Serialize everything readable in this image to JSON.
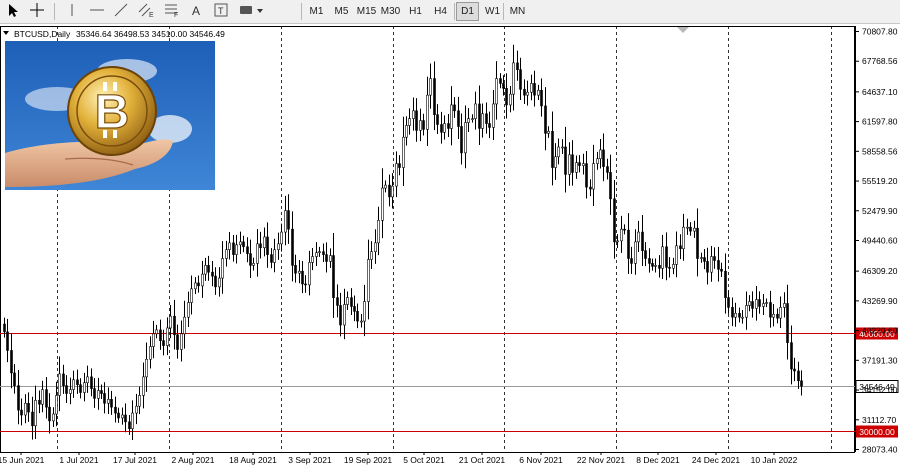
{
  "toolbar": {
    "tools": [
      {
        "icon": "cursor-arrow-icon"
      },
      {
        "icon": "crosshair-icon"
      },
      {
        "icon": "vertical-line-icon"
      },
      {
        "icon": "horizontal-line-icon"
      },
      {
        "icon": "trendline-icon"
      },
      {
        "icon": "channel-icon",
        "label": "E"
      },
      {
        "icon": "fibonacci-icon",
        "label": "F"
      },
      {
        "icon": "text-tool-icon",
        "label": "A"
      },
      {
        "icon": "text-label-icon",
        "label": "T"
      },
      {
        "icon": "shapes-icon"
      }
    ],
    "timeframes": [
      "M1",
      "M5",
      "M15",
      "M30",
      "H1",
      "H4",
      "D1",
      "W1",
      "MN"
    ],
    "active_timeframe": "D1"
  },
  "chart_data": {
    "type": "candlestick",
    "symbol": "BTCUSD,Daily",
    "ohlc_header": "35346.64 36498.53 34510.00 34546.49",
    "y_ticks": [
      "70807.80",
      "67768.56",
      "64637.10",
      "61597.80",
      "58558.56",
      "55519.20",
      "52479.90",
      "49440.60",
      "46309.20",
      "43269.90",
      "40230.60",
      "37191.30",
      "34152.00",
      "31112.70",
      "28073.40"
    ],
    "ylim": [
      28073.4,
      70807.8
    ],
    "x_labels": [
      "15 Jun 2021",
      "1 Jul 2021",
      "17 Jul 2021",
      "2 Aug 2021",
      "18 Aug 2021",
      "3 Sep 2021",
      "19 Sep 2021",
      "5 Oct 2021",
      "21 Oct 2021",
      "6 Nov 2021",
      "22 Nov 2021",
      "8 Dec 2021",
      "24 Dec 2021",
      "10 Jan 2022"
    ],
    "levels": [
      {
        "value": 40000.0,
        "label": "40000.00",
        "color": "#cc0000"
      },
      {
        "value": 30000.0,
        "label": "30000.00",
        "color": "#cc0000"
      }
    ],
    "current_price": {
      "value": 34546.49,
      "label": "34546.49"
    },
    "closes": [
      40100,
      38200,
      35900,
      34600,
      32100,
      31600,
      32800,
      31900,
      30500,
      33100,
      32700,
      34200,
      32400,
      31000,
      31700,
      33600,
      35800,
      34600,
      33800,
      34200,
      35200,
      34700,
      33900,
      34900,
      35500,
      34300,
      33300,
      34100,
      33800,
      32800,
      33200,
      32400,
      31800,
      31300,
      31600,
      30900,
      30200,
      31800,
      32500,
      33600,
      35500,
      37300,
      38600,
      39900,
      40300,
      39200,
      38700,
      40500,
      41700,
      39800,
      38300,
      39900,
      41600,
      43100,
      44500,
      45100,
      44800,
      46000,
      46900,
      46200,
      45800,
      44700,
      45600,
      47600,
      48500,
      49200,
      48000,
      49000,
      49300,
      48800,
      48100,
      46900,
      47100,
      49100,
      48700,
      49800,
      48000,
      47200,
      48500,
      49100,
      50300,
      52500,
      50600,
      46900,
      46100,
      46300,
      45000,
      44900,
      47200,
      47800,
      48200,
      48300,
      48000,
      47300,
      47900,
      43600,
      42800,
      40800,
      42900,
      43600,
      42700,
      42200,
      41200,
      41200,
      43200,
      47500,
      48300,
      49200,
      51500,
      54800,
      55100,
      53900,
      55000,
      57300,
      56900,
      60000,
      61200,
      61900,
      62700,
      60700,
      61700,
      60800,
      64300,
      66000,
      62300,
      61300,
      60500,
      61400,
      60900,
      63300,
      62700,
      61100,
      58400,
      61500,
      61900,
      61900,
      63400,
      60900,
      62400,
      61400,
      61000,
      63400,
      66000,
      65500,
      65000,
      63300,
      64400,
      67600,
      66900,
      64900,
      64300,
      64600,
      65500,
      64300,
      64800,
      63200,
      60400,
      60600,
      56900,
      58000,
      59000,
      59000,
      56200,
      58200,
      56400,
      57400,
      57100,
      57300,
      54900,
      54700,
      57300,
      57800,
      58700,
      57000,
      56400,
      53700,
      49300,
      49400,
      50600,
      50500,
      47600,
      47100,
      49300,
      50300,
      48400,
      47600,
      47100,
      46800,
      46900,
      46600,
      48800,
      46700,
      46600,
      47000,
      48900,
      48600,
      50800,
      50800,
      50400,
      50700,
      47600,
      47700,
      47300,
      46200,
      47800,
      47400,
      46500,
      46300,
      43600,
      42600,
      41600,
      42000,
      41600,
      41600,
      42800,
      43200,
      42500,
      43400,
      42700,
      43000,
      43100,
      41600,
      41900,
      41500,
      42600,
      43000,
      39000,
      36300,
      36100,
      35100,
      34546
    ]
  },
  "image": {
    "alt": "hand holding a gold bitcoin coin"
  },
  "colors": {
    "grid": "#000000",
    "level": "#cc0000",
    "candle_up": "#ffffff",
    "candle_down": "#000000",
    "sky": "#2f72c5"
  }
}
